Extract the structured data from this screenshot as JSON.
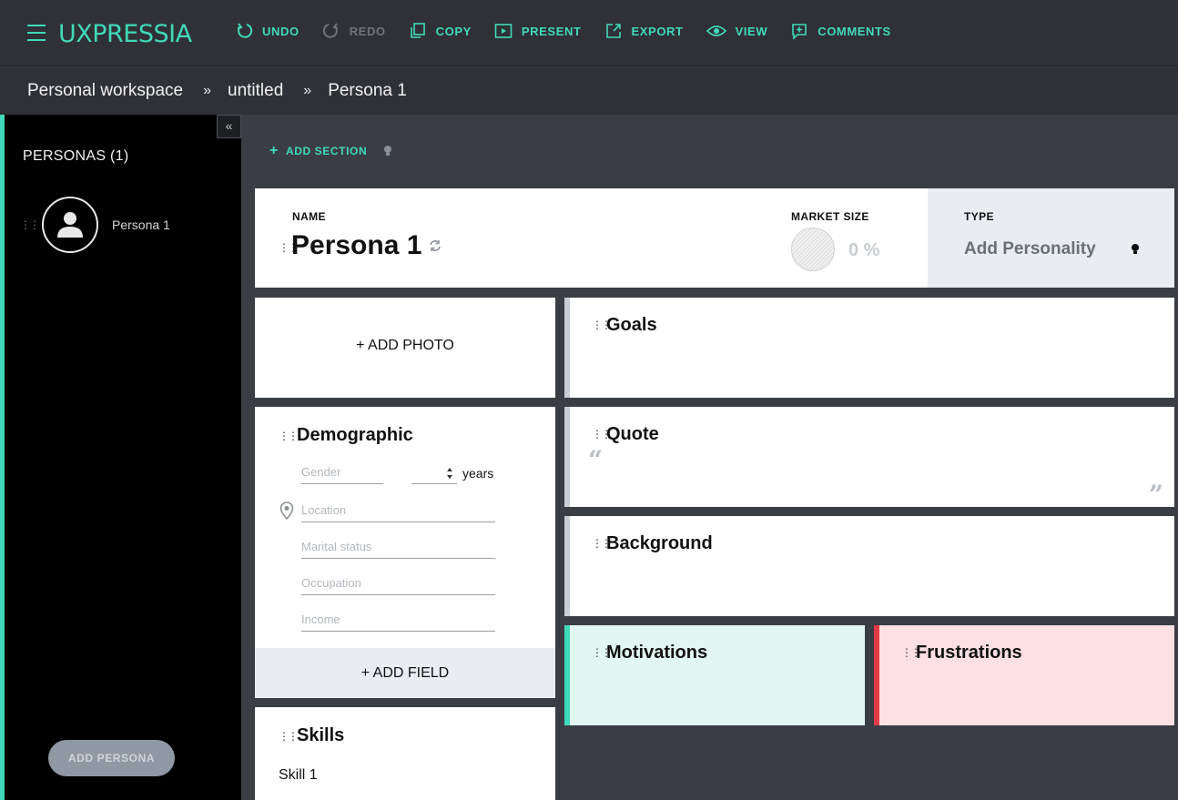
{
  "app": {
    "logo": "UXPRESSIA"
  },
  "toolbar": {
    "undo": "UNDO",
    "redo": "REDO",
    "copy": "COPY",
    "present": "PRESENT",
    "export": "EXPORT",
    "view": "VIEW",
    "comments": "COMMENTS"
  },
  "breadcrumb": {
    "items": [
      "Personal workspace",
      "untitled",
      "Persona 1"
    ]
  },
  "sidebar": {
    "title": "PERSONAS (1)",
    "persona_name": "Persona 1",
    "add_button": "ADD PERSONA"
  },
  "canvas": {
    "add_section": "ADD SECTION",
    "name_label": "NAME",
    "persona_name": "Persona 1",
    "market_label": "MARKET SIZE",
    "market_value": "0 %",
    "type_label": "TYPE",
    "type_value": "Add Personality",
    "add_photo": "+ ADD PHOTO",
    "goals": "Goals",
    "quote": "Quote",
    "background": "Background",
    "motivations": "Motivations",
    "frustrations": "Frustrations",
    "demographic": {
      "title": "Demographic",
      "gender_placeholder": "Gender",
      "years": "years",
      "location_placeholder": "Location",
      "marital_placeholder": "Marital status",
      "occupation_placeholder": "Occupation",
      "income_placeholder": "Income",
      "add_field": "+ ADD FIELD"
    },
    "skills": {
      "title": "Skills",
      "skill1": "Skill 1"
    }
  },
  "colors": {
    "accent": "#41d9b9",
    "frustration": "#e23b48"
  }
}
